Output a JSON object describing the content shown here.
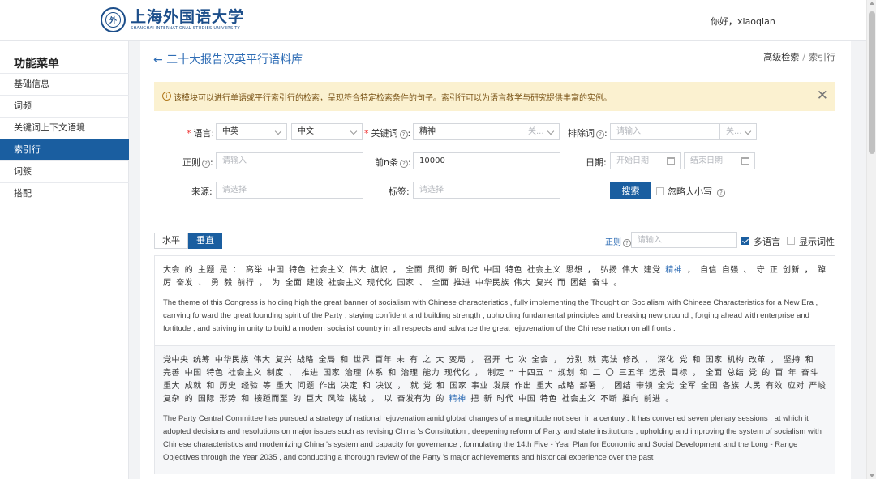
{
  "header": {
    "logo_cn": "上海外国语大学",
    "logo_en": "SHANGHAI INTERNATIONAL STUDIES UNIVERSITY",
    "seal_char": "外",
    "greeting": "你好，xiaoqian"
  },
  "sidebar": {
    "title": "功能菜单",
    "items": [
      {
        "label": "基础信息"
      },
      {
        "label": "词频"
      },
      {
        "label": "关键词上下文语境"
      },
      {
        "label": "索引行",
        "active": true
      },
      {
        "label": "词簇"
      },
      {
        "label": "搭配"
      }
    ]
  },
  "page": {
    "back": "← 二十大报告汉英平行语料库",
    "breadcrumb": {
      "parent": "高级检索",
      "sep": "/",
      "current": "索引行"
    }
  },
  "alert": {
    "text": "该模块可以进行单语或平行索引行的检索，呈现符合特定检索条件的句子。索引行可以为语言教学与研究提供丰富的实例。",
    "close": "✕"
  },
  "form": {
    "language_label": "语言:",
    "language_value": "中英",
    "language2_value": "中文",
    "keyword_label": "关键词",
    "keyword_value": "精神",
    "keyword_option": "关...",
    "exclude_label": "排除词",
    "exclude_placeholder": "请输入",
    "exclude_option": "关...",
    "regex_label": "正则",
    "regex_placeholder": "请输入",
    "topn_label": "前n条",
    "topn_value": "10000",
    "date_label": "日期:",
    "start_date_placeholder": "开始日期",
    "end_date_placeholder": "结束日期",
    "source_label": "来源:",
    "source_placeholder": "请选择",
    "tag_label": "标签:",
    "tag_placeholder": "请选择",
    "search_button": "搜索",
    "ignore_case_label": "忽略大小写"
  },
  "view": {
    "horizontal": "水平",
    "vertical": "垂直",
    "regex_label": "正则",
    "regex_placeholder": "请输入",
    "multilingual_label": "多语言",
    "multilingual_checked": true,
    "show_pos_label": "显示词性",
    "show_pos_checked": false
  },
  "results": [
    {
      "zh_before": "大会 的 主题 是 ： 高举 中国 特色 社会主义 伟大 旗帜 ， 全面 贯彻 新 时代 中国 特色 社会主义 思想 ， 弘扬 伟大 建党 ",
      "zh_hit": "精神",
      "zh_after": " ， 自信 自强 、 守 正 创新 ， 踔 厉 奋发 、 勇 毅 前行 ， 为 全面 建设 社会主义 现代化 国家 、 全面 推进 中华民族 伟大 复兴 而 团结 奋斗 。",
      "en": "The theme of this Congress is holding high the great banner of socialism with Chinese characteristics , fully implementing the Thought on Socialism with Chinese Characteristics for a New Era , carrying forward the great founding spirit of the Party , staying confident and building strength , upholding fundamental principles and breaking new ground , forging ahead with enterprise and fortitude , and striving in unity to build a modern socialist country in all respects and advance the great rejuvenation of the Chinese nation on all fronts ."
    },
    {
      "zh_before": "党中央 统筹 中华民族 伟大 复兴 战略 全局 和 世界 百年 未 有 之 大 变局 ， 召开 七 次 全会 ， 分别 就 宪法 修改 ， 深化 党 和 国家 机构 改革 ， 坚持 和 完善 中国 特色 社会主义 制度 、 推进 国家 治理 体系 和 治理 能力 现代化 ， 制定 “ 十四五 ” 规划 和 二 〇 三五年 远景 目标 ， 全面 总结 党 的 百 年 奋斗 重大 成就 和 历史 经验 等 重大 问题 作出 决定 和 决议 ， 就 党 和 国家 事业 发展 作出 重大 战略 部署 ， 团结 带领 全党 全军 全国 各族 人民 有效 应对 严峻 复杂 的 国际 形势 和 接踵而至 的 巨大 风险 挑战 ， 以 奋发有为 的 ",
      "zh_hit": "精神",
      "zh_after": " 把 新 时代 中国 特色 社会主义 不断 推向 前进 。",
      "en": "The Party Central Committee has pursued a strategy of national rejuvenation amid global changes of a magnitude not seen in a century . It has convened seven plenary sessions , at which it adopted decisions and resolutions on major issues such as revising China 's Constitution , deepening reform of Party and state institutions , upholding and improving the system of socialism with Chinese characteristics and modernizing China 's system and capacity for governance , formulating the 14th Five - Year Plan for Economic and Social Development and the Long - Range Objectives through the Year 2035 , and conducting a thorough review of the Party 's major achievements and historical experience over the past"
    }
  ]
}
